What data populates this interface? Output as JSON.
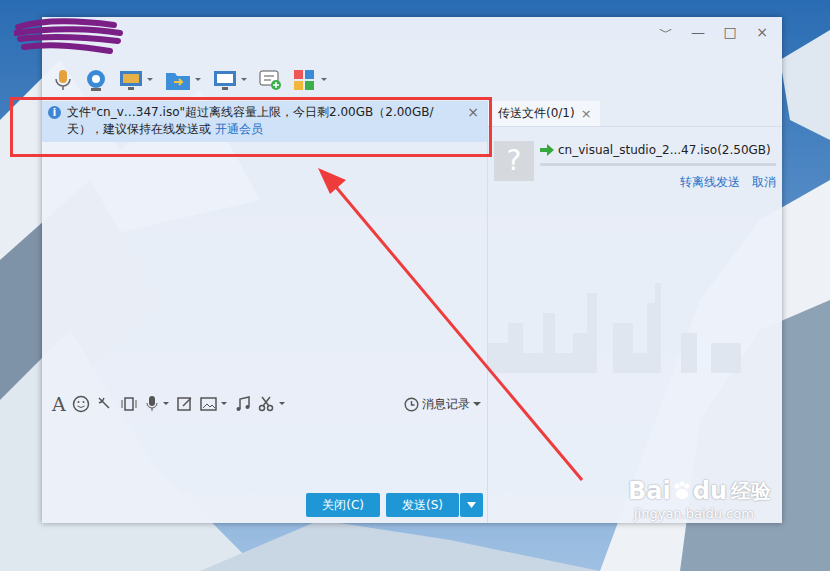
{
  "window": {
    "controls": [
      "﹀",
      "—",
      "□",
      "×"
    ]
  },
  "notice": {
    "icon": "i",
    "text": "文件\"cn_v…347.iso\"超过离线容量上限，今日剩2.00GB（2.00GB/天），建议保持在线发送或",
    "link": "开通会员",
    "close": "×"
  },
  "transfer": {
    "tab": {
      "label": "传送文件(0/1)",
      "selected": true,
      "close": "×"
    },
    "file": {
      "icon": "?",
      "name": "cn_visual_studio_2...47.iso(2.50GB)",
      "level": 0
    },
    "actions": [
      "转离线发送",
      "取消"
    ]
  },
  "input_toolbar": {
    "font_icon": "A",
    "history": "消息记录"
  },
  "buttons": [
    {
      "label": "关闭(C)"
    },
    {
      "label": "发送(S)"
    }
  ],
  "watermark": {
    "brand_a": "Bai",
    "brand_b": "du",
    "brand_cn": "经验",
    "url": "jingyan.baidu.com"
  }
}
